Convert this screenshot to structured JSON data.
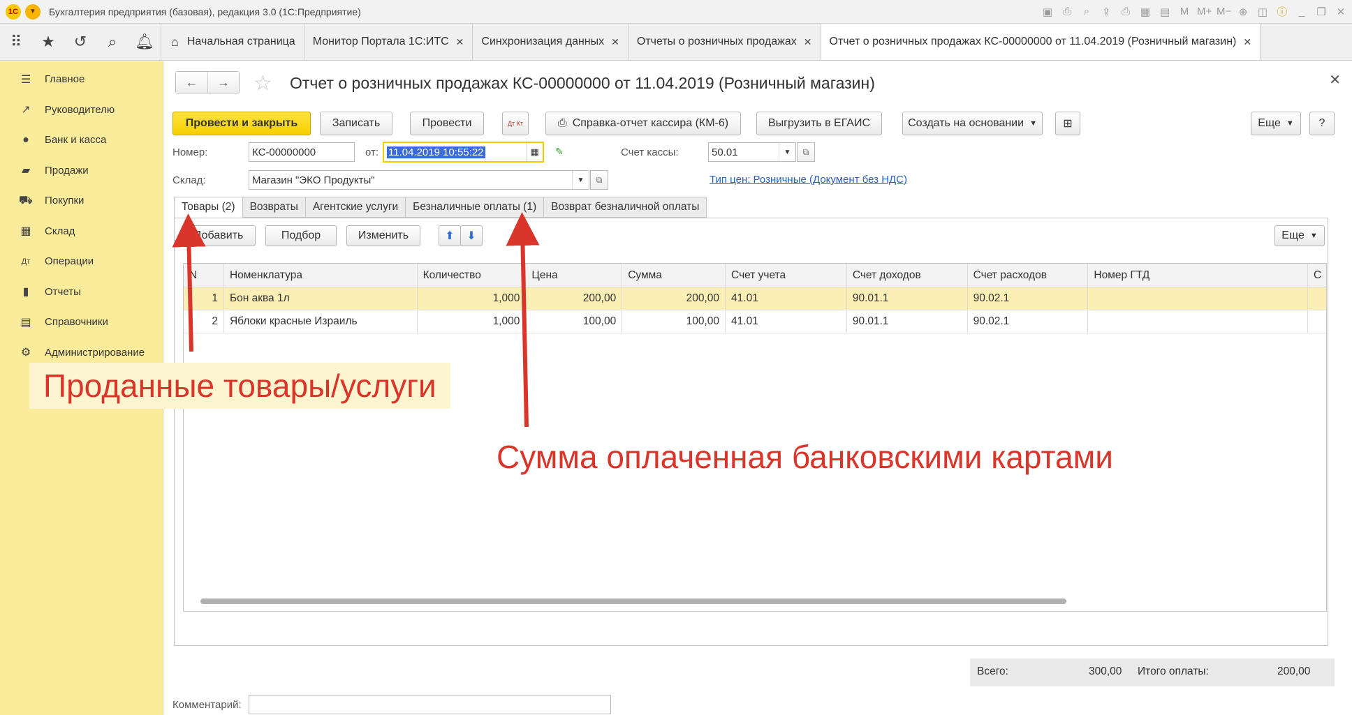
{
  "window": {
    "title": "Бухгалтерия предприятия (базовая), редакция 3.0 (1С:Предприятие)"
  },
  "tabs": [
    {
      "label": "Начальная страница"
    },
    {
      "label": "Монитор Портала 1С:ИТС"
    },
    {
      "label": "Синхронизация данных"
    },
    {
      "label": "Отчеты о розничных продажах"
    },
    {
      "label": "Отчет о розничных продажах КС-00000000 от 11.04.2019 (Розничный магазин)"
    }
  ],
  "sidebar": {
    "items": [
      {
        "label": "Главное"
      },
      {
        "label": "Руководителю"
      },
      {
        "label": "Банк и касса"
      },
      {
        "label": "Продажи"
      },
      {
        "label": "Покупки"
      },
      {
        "label": "Склад"
      },
      {
        "label": "Операции"
      },
      {
        "label": "Отчеты"
      },
      {
        "label": "Справочники"
      },
      {
        "label": "Администрирование"
      }
    ]
  },
  "document": {
    "title": "Отчет о розничных продажах КС-00000000 от 11.04.2019 (Розничный магазин)",
    "toolbar": {
      "post_close": "Провести и закрыть",
      "save": "Записать",
      "post": "Провести",
      "dt_kt": "Дт Кт",
      "km6": "Справка-отчет кассира (КМ-6)",
      "egais": "Выгрузить в ЕГАИС",
      "create_based": "Создать на основании",
      "more": "Еще",
      "help": "?"
    },
    "number_label": "Номер:",
    "number_value": "КС-00000000",
    "from_label": "от:",
    "date_value": "11.04.2019 10:55:22",
    "cash_account_label": "Счет кассы:",
    "cash_account_value": "50.01",
    "warehouse_label": "Склад:",
    "warehouse_value": "Магазин \"ЭКО Продукты\"",
    "price_type_link": "Тип цен: Розничные (Документ без НДС)",
    "doc_tabs": [
      {
        "label": "Товары (2)"
      },
      {
        "label": "Возвраты"
      },
      {
        "label": "Агентские услуги"
      },
      {
        "label": "Безналичные оплаты (1)"
      },
      {
        "label": "Возврат безналичной оплаты"
      }
    ],
    "table_toolbar": {
      "add": "Добавить",
      "select": "Подбор",
      "change": "Изменить",
      "more": "Еще"
    },
    "columns": [
      "N",
      "Номенклатура",
      "Количество",
      "Цена",
      "Сумма",
      "Счет учета",
      "Счет доходов",
      "Счет расходов",
      "Номер ГТД",
      "С"
    ],
    "rows": [
      {
        "n": "1",
        "name": "Бон аква 1л",
        "qty": "1,000",
        "price": "200,00",
        "sum": "200,00",
        "acc": "41.01",
        "income": "90.01.1",
        "expense": "90.02.1",
        "gtd": ""
      },
      {
        "n": "2",
        "name": "Яблоки красные Израиль",
        "qty": "1,000",
        "price": "100,00",
        "sum": "100,00",
        "acc": "41.01",
        "income": "90.01.1",
        "expense": "90.02.1",
        "gtd": ""
      }
    ],
    "totals": {
      "total_label": "Всего:",
      "total_value": "300,00",
      "paid_label": "Итого оплаты:",
      "paid_value": "200,00"
    },
    "comment_label": "Комментарий:"
  },
  "annotations": {
    "sold_goods": "Проданные товары/услуги",
    "card_sum": "Сумма оплаченная банковскими картами",
    "color": "#d9352b"
  }
}
